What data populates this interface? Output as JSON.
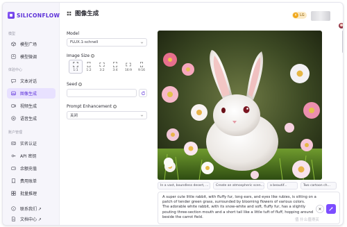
{
  "brand": {
    "name": "SILICONFLOW",
    "accent": "#6a38e6",
    "active_bg": "#e8e1ff"
  },
  "sidebar": {
    "sections": [
      {
        "title": "模型",
        "items": [
          {
            "label": "模型广场",
            "icon": "cube-icon",
            "active": false
          },
          {
            "label": "模型微调",
            "icon": "tune-icon",
            "active": false
          }
        ]
      },
      {
        "title": "体验中心",
        "items": [
          {
            "label": "文本对话",
            "icon": "chat-icon",
            "active": false
          },
          {
            "label": "图像生成",
            "icon": "image-icon",
            "active": true
          },
          {
            "label": "视频生成",
            "icon": "video-icon",
            "active": false
          },
          {
            "label": "语音生成",
            "icon": "audio-icon",
            "active": false
          }
        ]
      },
      {
        "title": "账户管理",
        "items": [
          {
            "label": "实名认证",
            "icon": "id-card-icon",
            "active": false
          },
          {
            "label": "API 密钥",
            "icon": "key-icon",
            "active": false
          },
          {
            "label": "余额充值",
            "icon": "wallet-icon",
            "active": false
          },
          {
            "label": "费用账单",
            "icon": "bill-icon",
            "active": false
          },
          {
            "label": "批量推理",
            "icon": "batch-icon",
            "active": false
          }
        ]
      }
    ],
    "footer": [
      {
        "label": "联系我们 ↗",
        "icon": "contact-icon"
      },
      {
        "label": "文档中心 ↗",
        "icon": "doc-icon"
      }
    ]
  },
  "header": {
    "title": "图像生成",
    "coin_label": "LG"
  },
  "controls": {
    "model_label": "Model",
    "model_value": "FLUX.1-schnell",
    "size_label": "Image Size",
    "sizes": [
      {
        "label": "1:1",
        "selected": true
      },
      {
        "label": "1:2",
        "selected": false
      },
      {
        "label": "3:2",
        "selected": false
      },
      {
        "label": "3:4",
        "selected": false
      },
      {
        "label": "16:9",
        "selected": false
      },
      {
        "label": "9:16",
        "selected": false
      }
    ],
    "seed_label": "Seed",
    "seed_value": "",
    "enhance_label": "Prompt Enhancement",
    "enhance_value": "关闭"
  },
  "suggestions": [
    "In a vast, boundless desert, ...",
    "Create an atmospheric scen...",
    "a beautif...",
    "Two cartoon ch..."
  ],
  "prompt": {
    "lines": [
      "A super cute little rabbit, with fluffy fur, long ears, and eyes like rubies, is sitting on a patch of tender green grass, surrounded by blooming flowers of various colors.",
      "The adorable white rabbit, with its snow-white and soft, fluffy fur, has a slightly pouting three-section mouth and a short tail like a little tuft of fluff, hopping around beside the carrot field."
    ]
  },
  "watermark": "值 什么值得买"
}
